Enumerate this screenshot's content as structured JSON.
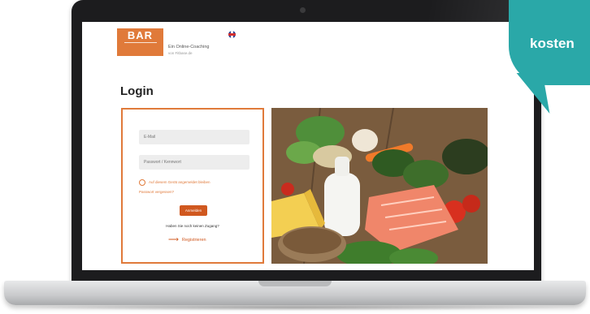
{
  "header": {
    "logo_text": "BAR",
    "tagline": "Ein Online-Coaching",
    "tagline_sub": "von Fitbase.de",
    "language_flag": "uk-flag-icon"
  },
  "page_title": "Login",
  "login_form": {
    "username_placeholder": "E-Mail",
    "password_placeholder": "Passwort / Kennwort",
    "remember_label": "Auf diesem Gerät angemeldet bleiben",
    "forgot_label": "Passwort vergessen?",
    "login_button": "Anmelden",
    "no_access_text": "Haben Sie noch keinen Zugang?",
    "register_link": "Registrieren"
  },
  "hero_image": "healthy-food-photo",
  "badge": {
    "text": "kosten",
    "color": "#2aa8a8"
  },
  "colors": {
    "accent": "#e07a3a",
    "button": "#d0581f"
  }
}
